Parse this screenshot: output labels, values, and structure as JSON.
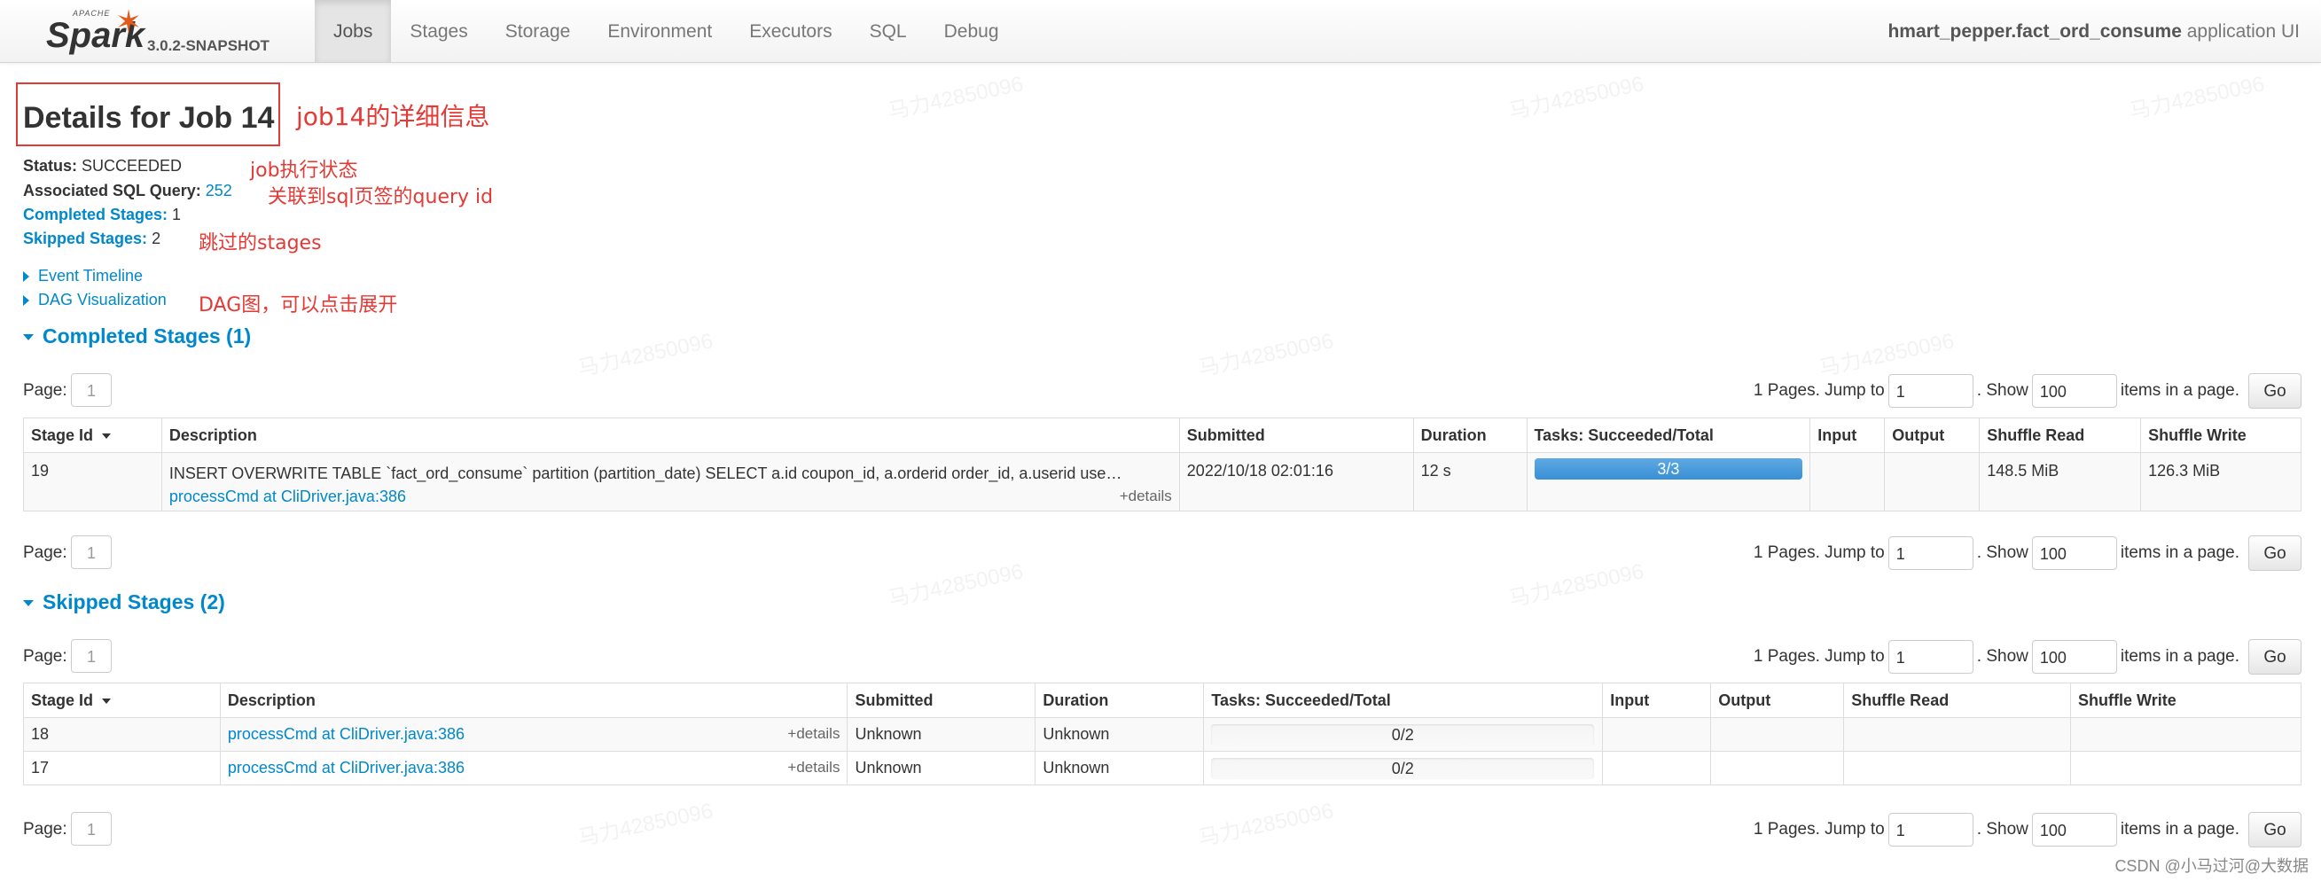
{
  "nav": {
    "brand_top": "APACHE",
    "brand": "Spark",
    "version": "3.0.2-SNAPSHOT",
    "tabs": [
      "Jobs",
      "Stages",
      "Storage",
      "Environment",
      "Executors",
      "SQL",
      "Debug"
    ],
    "active_tab": "Jobs",
    "app_name": "hmart_pepper.fact_ord_consume",
    "app_suffix": "application UI"
  },
  "header": {
    "title": "Details for Job 14"
  },
  "summary": {
    "status_label": "Status:",
    "status": "SUCCEEDED",
    "sql_label": "Associated SQL Query:",
    "sql_id": "252",
    "completed_label": "Completed Stages:",
    "completed": "1",
    "skipped_label": "Skipped Stages:",
    "skipped": "2"
  },
  "links": {
    "event_timeline": "Event Timeline",
    "dag": "DAG Visualization"
  },
  "annotations": {
    "job": "job14的详细信息",
    "status": "job执行状态",
    "sql": "关联到sql页签的query id",
    "skipped": "跳过的stages",
    "dag": "DAG图，可以点击展开"
  },
  "pager": {
    "page_label": "Page:",
    "page": "1",
    "pages_text": "1 Pages. Jump to",
    "jump": "1",
    "show_text": ". Show",
    "show": "100",
    "items_text": "items in a page.",
    "go": "Go"
  },
  "completed": {
    "title": "Completed Stages (1)",
    "headers": [
      "Stage Id",
      "Description",
      "Submitted",
      "Duration",
      "Tasks: Succeeded/Total",
      "Input",
      "Output",
      "Shuffle Read",
      "Shuffle Write"
    ],
    "rows": [
      {
        "id": "19",
        "desc": "INSERT OVERWRITE TABLE `fact_ord_consume` partition (partition_date) SELECT a.id coupon_id, a.orderid order_id, a.userid use…",
        "link": "processCmd at CliDriver.java:386",
        "details": "+details",
        "submitted": "2022/10/18 02:01:16",
        "duration": "12 s",
        "tasks": "3/3",
        "progress": 1.0,
        "input": "",
        "output": "",
        "shuffle_read": "148.5 MiB",
        "shuffle_write": "126.3 MiB"
      }
    ]
  },
  "skipped": {
    "title": "Skipped Stages (2)",
    "headers": [
      "Stage Id",
      "Description",
      "Submitted",
      "Duration",
      "Tasks: Succeeded/Total",
      "Input",
      "Output",
      "Shuffle Read",
      "Shuffle Write"
    ],
    "rows": [
      {
        "id": "18",
        "link": "processCmd at CliDriver.java:386",
        "details": "+details",
        "submitted": "Unknown",
        "duration": "Unknown",
        "tasks": "0/2",
        "progress": 0
      },
      {
        "id": "17",
        "link": "processCmd at CliDriver.java:386",
        "details": "+details",
        "submitted": "Unknown",
        "duration": "Unknown",
        "tasks": "0/2",
        "progress": 0
      }
    ]
  },
  "watermark": "马力42850096",
  "footer": "CSDN @小马过河@大数据"
}
